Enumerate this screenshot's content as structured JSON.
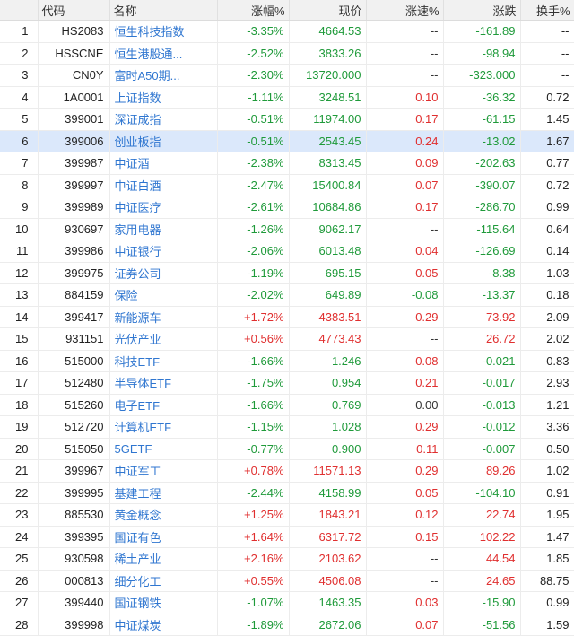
{
  "headers": {
    "code": "代码",
    "name": "名称",
    "pct": "涨幅%",
    "price": "现价",
    "speed": "涨速%",
    "change": "涨跌",
    "turnover": "换手%"
  },
  "colors": {
    "up": "#e02f2f",
    "down": "#1f9a3a",
    "name_blue": "#2f76d0",
    "name_purple": "#b236b2",
    "selected": "#dbe8fb"
  },
  "rows": [
    {
      "idx": "1",
      "code": "HS2083",
      "name": "恒生科技指数",
      "pct": "-3.35%",
      "price": "4664.53",
      "speed": "--",
      "change": "-161.89",
      "turnover": "--",
      "nameColor": "blue",
      "pctDir": "down",
      "priceDir": "down",
      "speedDir": "neutral",
      "changeDir": "down"
    },
    {
      "idx": "2",
      "code": "HSSCNE",
      "name": "恒生港股通...",
      "pct": "-2.52%",
      "price": "3833.26",
      "speed": "--",
      "change": "-98.94",
      "turnover": "--",
      "nameColor": "blue",
      "pctDir": "down",
      "priceDir": "down",
      "speedDir": "neutral",
      "changeDir": "down"
    },
    {
      "idx": "3",
      "code": "CN0Y",
      "name": "富时A50期...",
      "pct": "-2.30%",
      "price": "13720.000",
      "speed": "--",
      "change": "-323.000",
      "turnover": "--",
      "nameColor": "blue",
      "pctDir": "down",
      "priceDir": "down",
      "speedDir": "neutral",
      "changeDir": "down"
    },
    {
      "idx": "4",
      "code": "1A0001",
      "name": "上证指数",
      "pct": "-1.11%",
      "price": "3248.51",
      "speed": "0.10",
      "change": "-36.32",
      "turnover": "0.72",
      "nameColor": "blue",
      "pctDir": "down",
      "priceDir": "down",
      "speedDir": "up",
      "changeDir": "down"
    },
    {
      "idx": "5",
      "code": "399001",
      "name": "深证成指",
      "pct": "-0.51%",
      "price": "11974.00",
      "speed": "0.17",
      "change": "-61.15",
      "turnover": "1.45",
      "nameColor": "blue",
      "pctDir": "down",
      "priceDir": "down",
      "speedDir": "up",
      "changeDir": "down"
    },
    {
      "idx": "6",
      "code": "399006",
      "name": "创业板指",
      "pct": "-0.51%",
      "price": "2543.45",
      "speed": "0.24",
      "change": "-13.02",
      "turnover": "1.67",
      "nameColor": "blue",
      "pctDir": "down",
      "priceDir": "down",
      "speedDir": "up",
      "changeDir": "down",
      "selected": true
    },
    {
      "idx": "7",
      "code": "399987",
      "name": "中证酒",
      "pct": "-2.38%",
      "price": "8313.45",
      "speed": "0.09",
      "change": "-202.63",
      "turnover": "0.77",
      "nameColor": "purple",
      "pctDir": "down",
      "priceDir": "down",
      "speedDir": "up",
      "changeDir": "down"
    },
    {
      "idx": "8",
      "code": "399997",
      "name": "中证白酒",
      "pct": "-2.47%",
      "price": "15400.84",
      "speed": "0.07",
      "change": "-390.07",
      "turnover": "0.72",
      "nameColor": "blue",
      "pctDir": "down",
      "priceDir": "down",
      "speedDir": "up",
      "changeDir": "down"
    },
    {
      "idx": "9",
      "code": "399989",
      "name": "中证医疗",
      "pct": "-2.61%",
      "price": "10684.86",
      "speed": "0.17",
      "change": "-286.70",
      "turnover": "0.99",
      "nameColor": "purple",
      "pctDir": "down",
      "priceDir": "down",
      "speedDir": "up",
      "changeDir": "down"
    },
    {
      "idx": "10",
      "code": "930697",
      "name": "家用电器",
      "pct": "-1.26%",
      "price": "9062.17",
      "speed": "--",
      "change": "-115.64",
      "turnover": "0.64",
      "nameColor": "blue",
      "pctDir": "down",
      "priceDir": "down",
      "speedDir": "neutral",
      "changeDir": "down"
    },
    {
      "idx": "11",
      "code": "399986",
      "name": "中证银行",
      "pct": "-2.06%",
      "price": "6013.48",
      "speed": "0.04",
      "change": "-126.69",
      "turnover": "0.14",
      "nameColor": "blue",
      "pctDir": "down",
      "priceDir": "down",
      "speedDir": "up",
      "changeDir": "down"
    },
    {
      "idx": "12",
      "code": "399975",
      "name": "证券公司",
      "pct": "-1.19%",
      "price": "695.15",
      "speed": "0.05",
      "change": "-8.38",
      "turnover": "1.03",
      "nameColor": "purple",
      "pctDir": "down",
      "priceDir": "down",
      "speedDir": "up",
      "changeDir": "down"
    },
    {
      "idx": "13",
      "code": "884159",
      "name": "保险",
      "pct": "-2.02%",
      "price": "649.89",
      "speed": "-0.08",
      "change": "-13.37",
      "turnover": "0.18",
      "nameColor": "blue",
      "pctDir": "down",
      "priceDir": "down",
      "speedDir": "down",
      "changeDir": "down"
    },
    {
      "idx": "14",
      "code": "399417",
      "name": "新能源车",
      "pct": "+1.72%",
      "price": "4383.51",
      "speed": "0.29",
      "change": "73.92",
      "turnover": "2.09",
      "nameColor": "purple",
      "pctDir": "up",
      "priceDir": "up",
      "speedDir": "up",
      "changeDir": "up"
    },
    {
      "idx": "15",
      "code": "931151",
      "name": "光伏产业",
      "pct": "+0.56%",
      "price": "4773.43",
      "speed": "--",
      "change": "26.72",
      "turnover": "2.02",
      "nameColor": "purple",
      "pctDir": "up",
      "priceDir": "up",
      "speedDir": "neutral",
      "changeDir": "up"
    },
    {
      "idx": "16",
      "code": "515000",
      "name": "科技ETF",
      "pct": "-1.66%",
      "price": "1.246",
      "speed": "0.08",
      "change": "-0.021",
      "turnover": "0.83",
      "nameColor": "blue",
      "pctDir": "down",
      "priceDir": "down",
      "speedDir": "up",
      "changeDir": "down"
    },
    {
      "idx": "17",
      "code": "512480",
      "name": "半导体ETF",
      "pct": "-1.75%",
      "price": "0.954",
      "speed": "0.21",
      "change": "-0.017",
      "turnover": "2.93",
      "nameColor": "purple",
      "pctDir": "down",
      "priceDir": "down",
      "speedDir": "up",
      "changeDir": "down"
    },
    {
      "idx": "18",
      "code": "515260",
      "name": "电子ETF",
      "pct": "-1.66%",
      "price": "0.769",
      "speed": "0.00",
      "change": "-0.013",
      "turnover": "1.21",
      "nameColor": "blue",
      "pctDir": "down",
      "priceDir": "down",
      "speedDir": "neutral",
      "changeDir": "down"
    },
    {
      "idx": "19",
      "code": "512720",
      "name": "计算机ETF",
      "pct": "-1.15%",
      "price": "1.028",
      "speed": "0.29",
      "change": "-0.012",
      "turnover": "3.36",
      "nameColor": "purple",
      "pctDir": "down",
      "priceDir": "down",
      "speedDir": "up",
      "changeDir": "down"
    },
    {
      "idx": "20",
      "code": "515050",
      "name": "5GETF",
      "pct": "-0.77%",
      "price": "0.900",
      "speed": "0.11",
      "change": "-0.007",
      "turnover": "0.50",
      "nameColor": "blue",
      "pctDir": "down",
      "priceDir": "down",
      "speedDir": "up",
      "changeDir": "down"
    },
    {
      "idx": "21",
      "code": "399967",
      "name": "中证军工",
      "pct": "+0.78%",
      "price": "11571.13",
      "speed": "0.29",
      "change": "89.26",
      "turnover": "1.02",
      "nameColor": "purple",
      "pctDir": "up",
      "priceDir": "up",
      "speedDir": "up",
      "changeDir": "up"
    },
    {
      "idx": "22",
      "code": "399995",
      "name": "基建工程",
      "pct": "-2.44%",
      "price": "4158.99",
      "speed": "0.05",
      "change": "-104.10",
      "turnover": "0.91",
      "nameColor": "purple",
      "pctDir": "down",
      "priceDir": "down",
      "speedDir": "up",
      "changeDir": "down"
    },
    {
      "idx": "23",
      "code": "885530",
      "name": "黄金概念",
      "pct": "+1.25%",
      "price": "1843.21",
      "speed": "0.12",
      "change": "22.74",
      "turnover": "1.95",
      "nameColor": "purple",
      "pctDir": "up",
      "priceDir": "up",
      "speedDir": "up",
      "changeDir": "up"
    },
    {
      "idx": "24",
      "code": "399395",
      "name": "国证有色",
      "pct": "+1.64%",
      "price": "6317.72",
      "speed": "0.15",
      "change": "102.22",
      "turnover": "1.47",
      "nameColor": "purple",
      "pctDir": "up",
      "priceDir": "up",
      "speedDir": "up",
      "changeDir": "up"
    },
    {
      "idx": "25",
      "code": "930598",
      "name": "稀土产业",
      "pct": "+2.16%",
      "price": "2103.62",
      "speed": "--",
      "change": "44.54",
      "turnover": "1.85",
      "nameColor": "purple",
      "pctDir": "up",
      "priceDir": "up",
      "speedDir": "neutral",
      "changeDir": "up"
    },
    {
      "idx": "26",
      "code": "000813",
      "name": "细分化工",
      "pct": "+0.55%",
      "price": "4506.08",
      "speed": "--",
      "change": "24.65",
      "turnover": "88.75",
      "nameColor": "blue",
      "pctDir": "up",
      "priceDir": "up",
      "speedDir": "neutral",
      "changeDir": "up"
    },
    {
      "idx": "27",
      "code": "399440",
      "name": "国证钢铁",
      "pct": "-1.07%",
      "price": "1463.35",
      "speed": "0.03",
      "change": "-15.90",
      "turnover": "0.99",
      "nameColor": "blue",
      "pctDir": "down",
      "priceDir": "down",
      "speedDir": "up",
      "changeDir": "down"
    },
    {
      "idx": "28",
      "code": "399998",
      "name": "中证煤炭",
      "pct": "-1.89%",
      "price": "2672.06",
      "speed": "0.07",
      "change": "-51.56",
      "turnover": "1.59",
      "nameColor": "blue",
      "pctDir": "down",
      "priceDir": "down",
      "speedDir": "up",
      "changeDir": "down"
    }
  ]
}
